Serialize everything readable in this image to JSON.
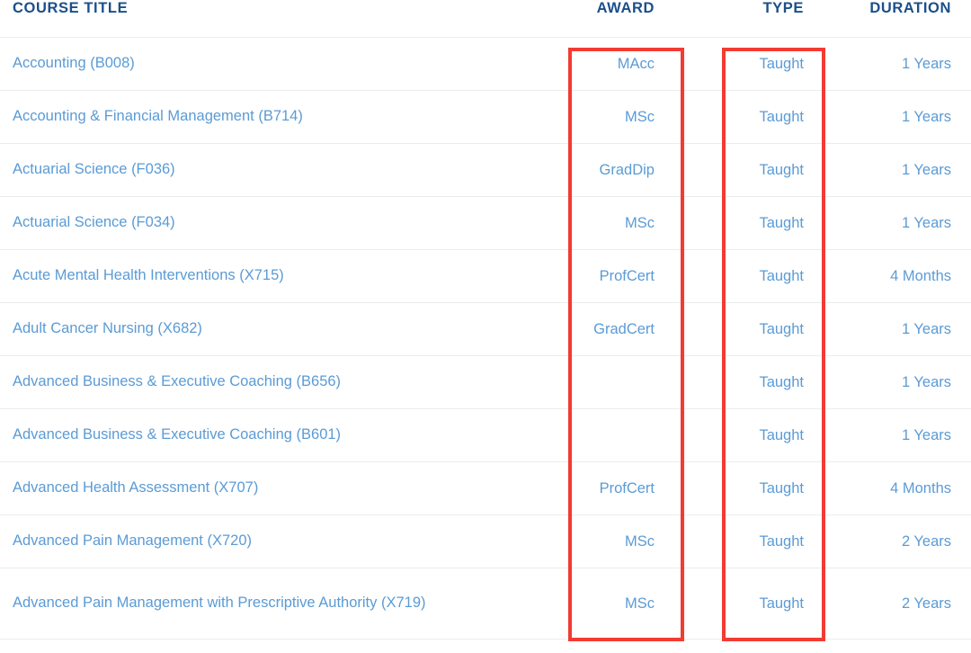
{
  "table": {
    "headers": {
      "title": "COURSE TITLE",
      "award": "AWARD",
      "type": "TYPE",
      "duration": "DURATION"
    },
    "rows": [
      {
        "title": "Accounting (B008)",
        "award": "MAcc",
        "type": "Taught",
        "duration": "1 Years"
      },
      {
        "title": "Accounting & Financial Management (B714)",
        "award": "MSc",
        "type": "Taught",
        "duration": "1 Years"
      },
      {
        "title": "Actuarial Science (F036)",
        "award": "GradDip",
        "type": "Taught",
        "duration": "1 Years"
      },
      {
        "title": "Actuarial Science (F034)",
        "award": "MSc",
        "type": "Taught",
        "duration": "1 Years"
      },
      {
        "title": "Acute Mental Health Interventions (X715)",
        "award": "ProfCert",
        "type": "Taught",
        "duration": "4 Months"
      },
      {
        "title": "Adult Cancer Nursing (X682)",
        "award": "GradCert",
        "type": "Taught",
        "duration": "1 Years"
      },
      {
        "title": "Advanced Business & Executive Coaching (B656)",
        "award": "",
        "type": "Taught",
        "duration": "1 Years"
      },
      {
        "title": "Advanced Business & Executive Coaching (B601)",
        "award": "",
        "type": "Taught",
        "duration": "1 Years"
      },
      {
        "title": "Advanced Health Assessment (X707)",
        "award": "ProfCert",
        "type": "Taught",
        "duration": "4 Months"
      },
      {
        "title": "Advanced Pain Management (X720)",
        "award": "MSc",
        "type": "Taught",
        "duration": "2 Years"
      },
      {
        "title": "Advanced Pain Management with Prescriptive Authority (X719)",
        "award": "MSc",
        "type": "Taught",
        "duration": "2 Years"
      }
    ]
  },
  "annotations": {
    "color": "#f23b33",
    "boxes": [
      {
        "label": "award-column-highlight"
      },
      {
        "label": "type-column-highlight"
      }
    ]
  },
  "colors": {
    "header_text": "#1b4f8a",
    "link_text": "#5b9bd5",
    "row_divider": "#e9ecef",
    "background": "#ffffff",
    "annotation": "#f23b33"
  }
}
